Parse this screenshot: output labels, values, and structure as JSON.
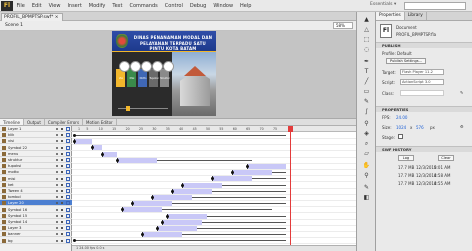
{
  "app_logo": "Fl",
  "menus": [
    "File",
    "Edit",
    "View",
    "Insert",
    "Modify",
    "Text",
    "Commands",
    "Control",
    "Debug",
    "Window",
    "Help"
  ],
  "workspace": "Essentials ▾",
  "search_placeholder": "",
  "document_tab": "PROFIL_BPMPTSP.swf* ×",
  "scene": "Scene 1",
  "zoom": "58%",
  "stage": {
    "banner_line1": "DINAS PENANAMAN MODAL DAN",
    "banner_line2": "PELAYANAN TERPADU SATU PINTU KOTA BATAM",
    "flow_labels": [
      "Visi",
      "Misi",
      "Motto",
      "Tupoksi",
      "Struktur"
    ]
  },
  "timeline_tabs": [
    "Timeline",
    "Output",
    "Compiler Errors",
    "Motion Editor"
  ],
  "layers": [
    {
      "name": "Layer 1",
      "selected": false
    },
    {
      "name": "klik",
      "selected": false
    },
    {
      "name": "visi",
      "selected": false
    },
    {
      "name": "Symbol 22",
      "selected": false
    },
    {
      "name": "menu",
      "selected": false
    },
    {
      "name": "struktur",
      "selected": false
    },
    {
      "name": "tupoksi",
      "selected": false
    },
    {
      "name": "motto",
      "selected": false
    },
    {
      "name": "misi",
      "selected": false
    },
    {
      "name": "ket",
      "selected": false
    },
    {
      "name": "Tween 4",
      "selected": false
    },
    {
      "name": "tombol",
      "selected": false
    },
    {
      "name": "Layer 20",
      "selected": true
    },
    {
      "name": "Symbol 16",
      "selected": false
    },
    {
      "name": "Symbol 15",
      "selected": false
    },
    {
      "name": "Symbol 14",
      "selected": false
    },
    {
      "name": "Layer 3",
      "selected": false
    },
    {
      "name": "banner",
      "selected": false
    },
    {
      "name": "bg",
      "selected": false
    }
  ],
  "ruler": [
    "1",
    "5",
    "10",
    "15",
    "20",
    "25",
    "30",
    "35",
    "40",
    "45",
    "50",
    "55",
    "60",
    "65",
    "70",
    "75"
  ],
  "timeline_status": "1   24.00 fps   0.0 s",
  "props": {
    "tabs": [
      "Properties",
      "Library"
    ],
    "doc_type": "Document",
    "doc_name": "PROFIL_BPMPTSP.fla",
    "publish_header": "PUBLISH",
    "profile_label": "Profile: Default",
    "settings_button": "Publish Settings...",
    "target_label": "Target:",
    "target_value": "Flash Player 11.2",
    "script_label": "Script:",
    "script_value": "ActionScript 3.0",
    "class_label": "Class:",
    "class_value": "",
    "properties_header": "PROPERTIES",
    "fps_label": "FPS:",
    "fps_value": "24.00",
    "size_label": "Size:",
    "size_w": "1024",
    "size_x": "x",
    "size_h": "576",
    "size_unit": "px",
    "stage_label": "Stage:",
    "swf_header": "SWF HISTORY",
    "log_button": "Log",
    "clear_button": "Clear",
    "history": [
      {
        "size": "17.7 MB",
        "date": "12/3/2018",
        "time": "5:01 AM"
      },
      {
        "size": "17.7 MB",
        "date": "12/3/2018",
        "time": "4:58 AM"
      },
      {
        "size": "17.7 MB",
        "date": "12/3/2018",
        "time": "4:55 AM"
      }
    ]
  },
  "colors": {
    "accent": "#e33b3b",
    "tween": "#c9c8f7",
    "banner": "#2f4da8",
    "selection": "#4c7fd1"
  }
}
